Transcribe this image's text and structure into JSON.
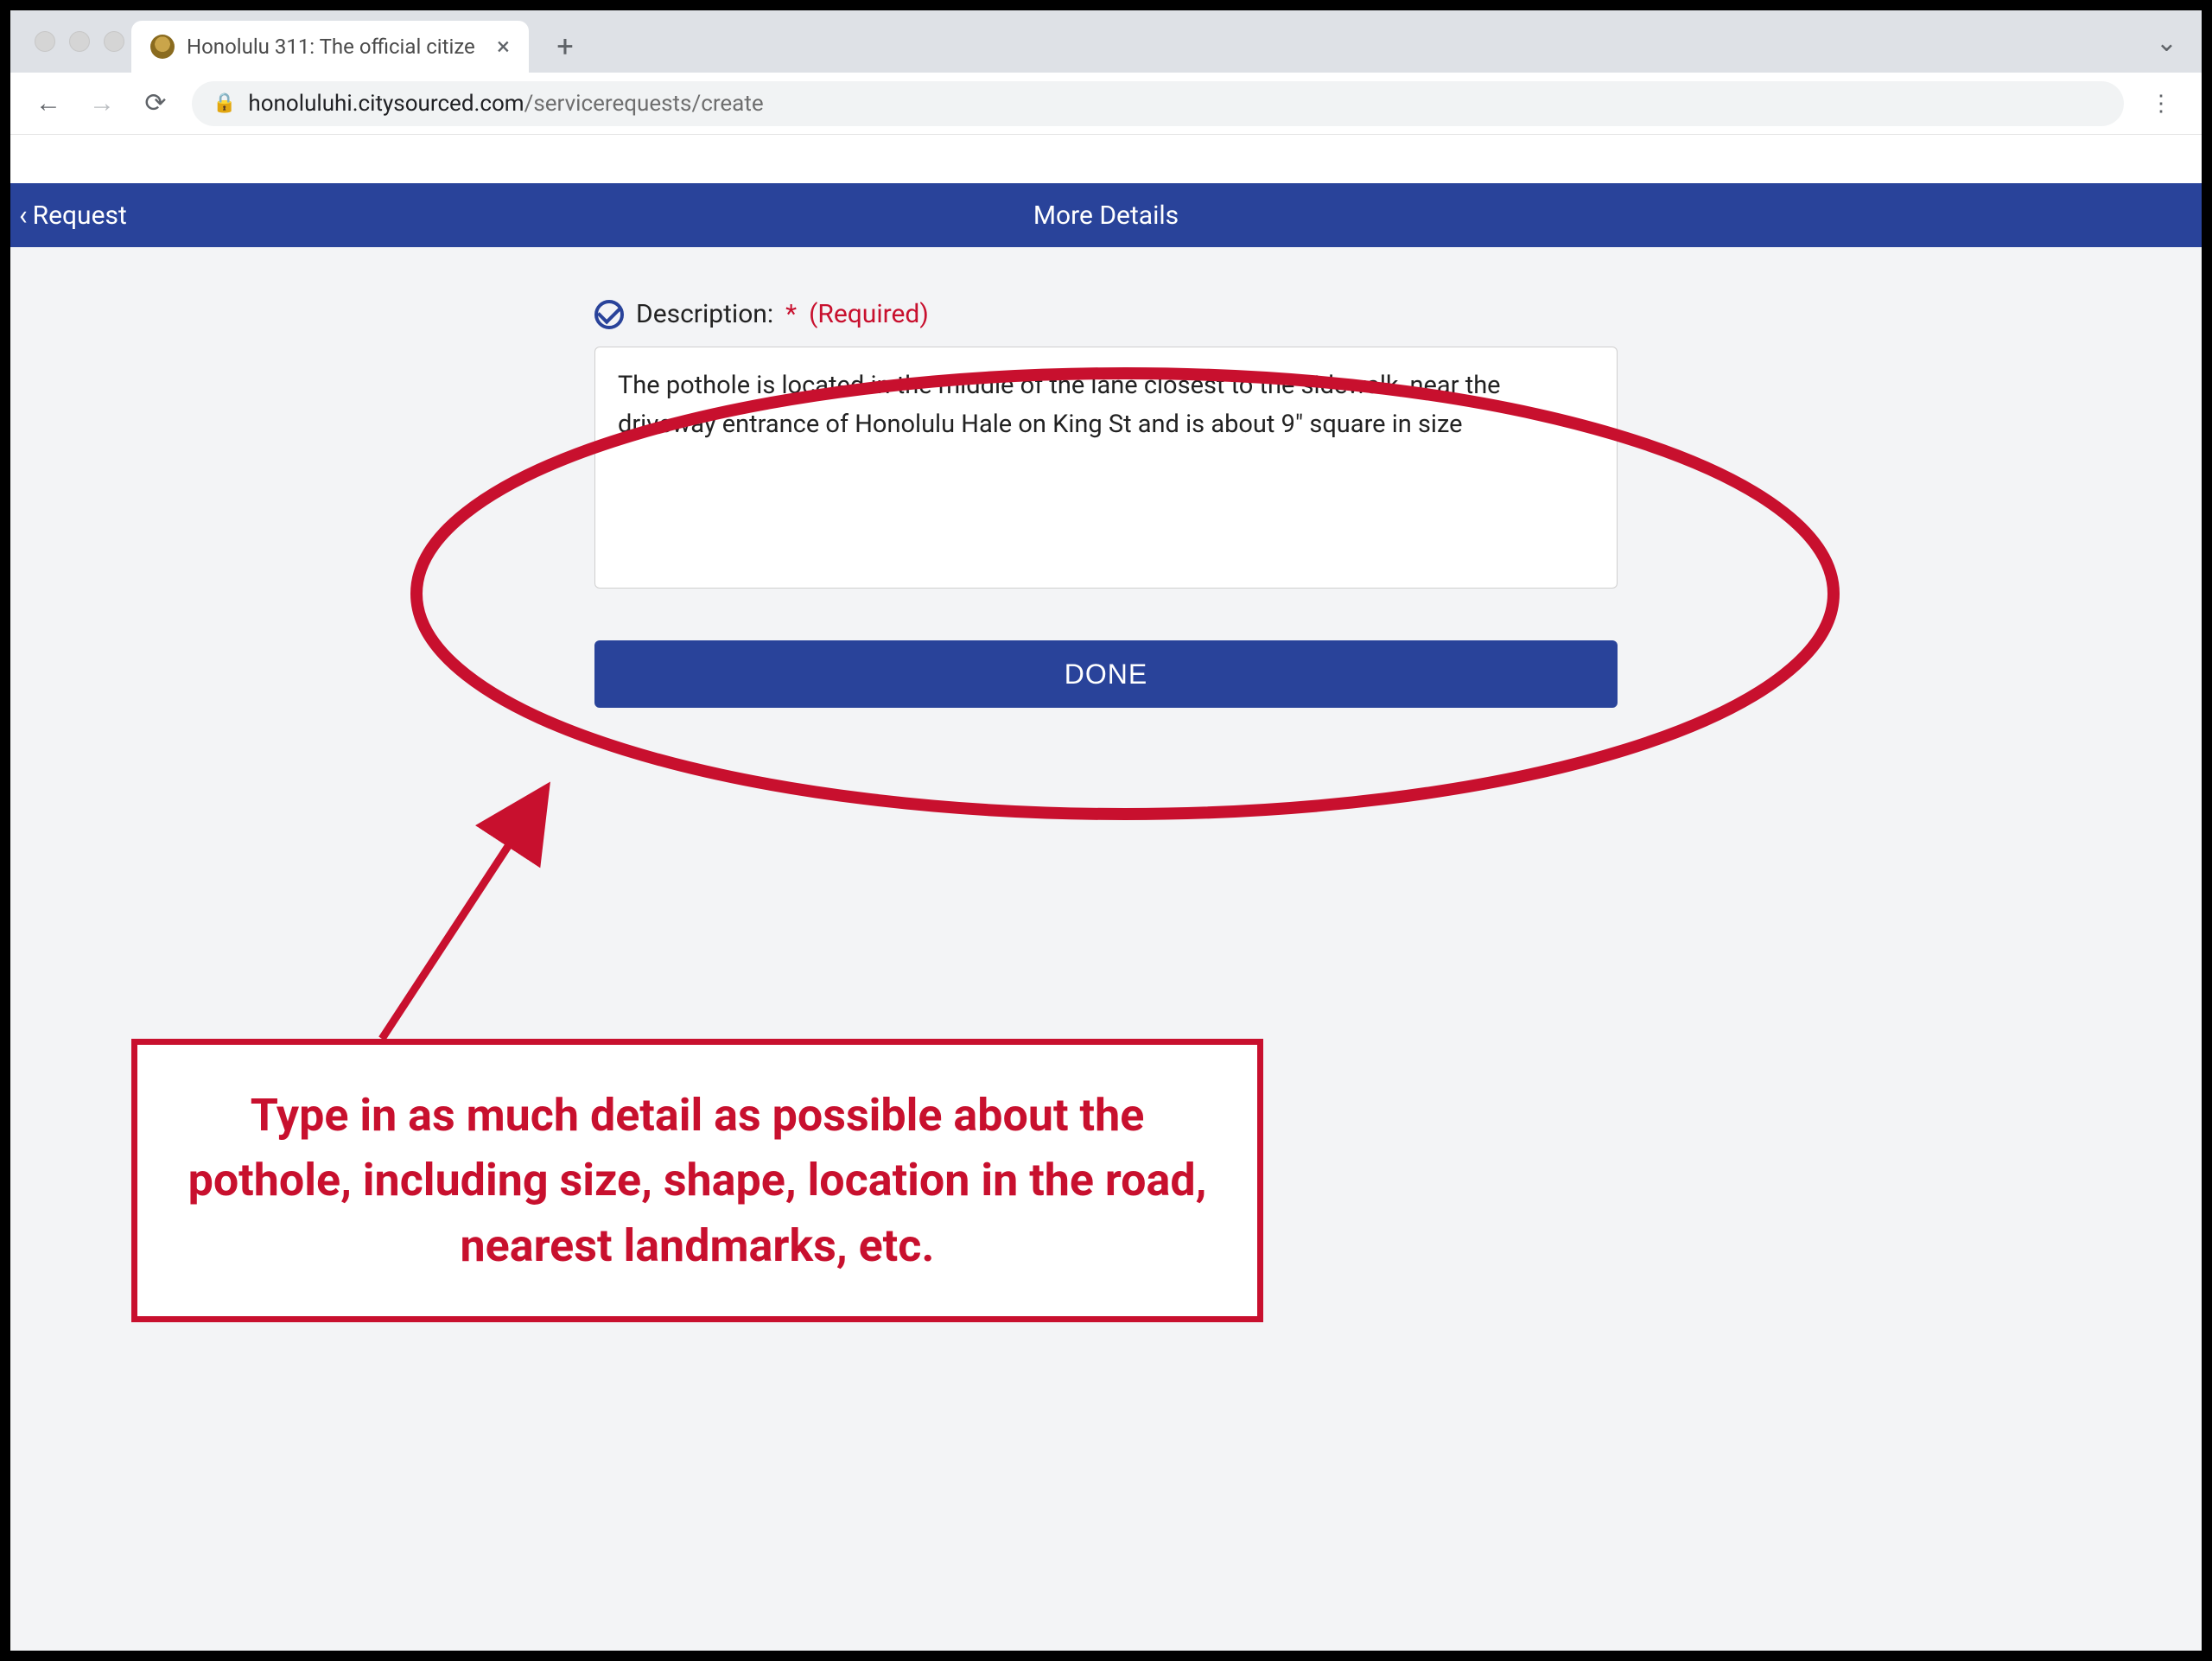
{
  "browser": {
    "tab_title": "Honolulu 311: The official citize",
    "url_host": "honoluluhi.citysourced.com",
    "url_path": "/servicerequests/create"
  },
  "header": {
    "back_label": "Request",
    "title": "More Details"
  },
  "form": {
    "description_label": "Description:",
    "required_star": "*",
    "required_text": "(Required)",
    "description_value": "The pothole is located in the middle of the lane closest to the sidewalk, near the driveway entrance of Honolulu Hale on King St and is about 9\" square in size",
    "done_label": "DONE"
  },
  "annotation": {
    "callout_text": "Type in as much detail as possible about the pothole, including size, shape, location in the road, nearest landmarks, etc."
  }
}
